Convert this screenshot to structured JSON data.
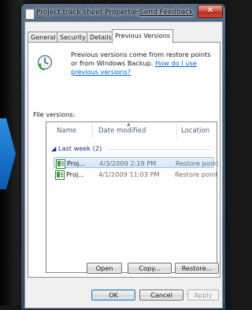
{
  "window": {
    "title": "Project track sheet Properties",
    "feedback_link": "Send Feedback",
    "close_label": "✕"
  },
  "tabs": [
    {
      "label": "General",
      "active": false
    },
    {
      "label": "Security",
      "active": false
    },
    {
      "label": "Details",
      "active": false
    },
    {
      "label": "Previous Versions",
      "active": true
    }
  ],
  "info": {
    "text": "Previous versions come from restore points or from Windows Backup.",
    "link": "How do I use previous versions?"
  },
  "file_versions": {
    "label": "File versions:",
    "columns": [
      "Name",
      "Date modified",
      "Location"
    ],
    "group": "Last week (2)",
    "rows": [
      {
        "name": "Proj...",
        "date": "4/3/2009 2:19 PM",
        "location": "Restore point",
        "selected": true
      },
      {
        "name": "Proj...",
        "date": "4/1/2009 11:03 PM",
        "location": "Restore point",
        "selected": false
      }
    ]
  },
  "actions": {
    "open": "Open",
    "copy": "Copy...",
    "restore": "Restore..."
  },
  "dialog_buttons": {
    "ok": "OK",
    "cancel": "Cancel",
    "apply": "Apply"
  },
  "colors": {
    "link": "#0066cc",
    "group_header": "#1e3287",
    "selection": "#d3e6fa"
  }
}
